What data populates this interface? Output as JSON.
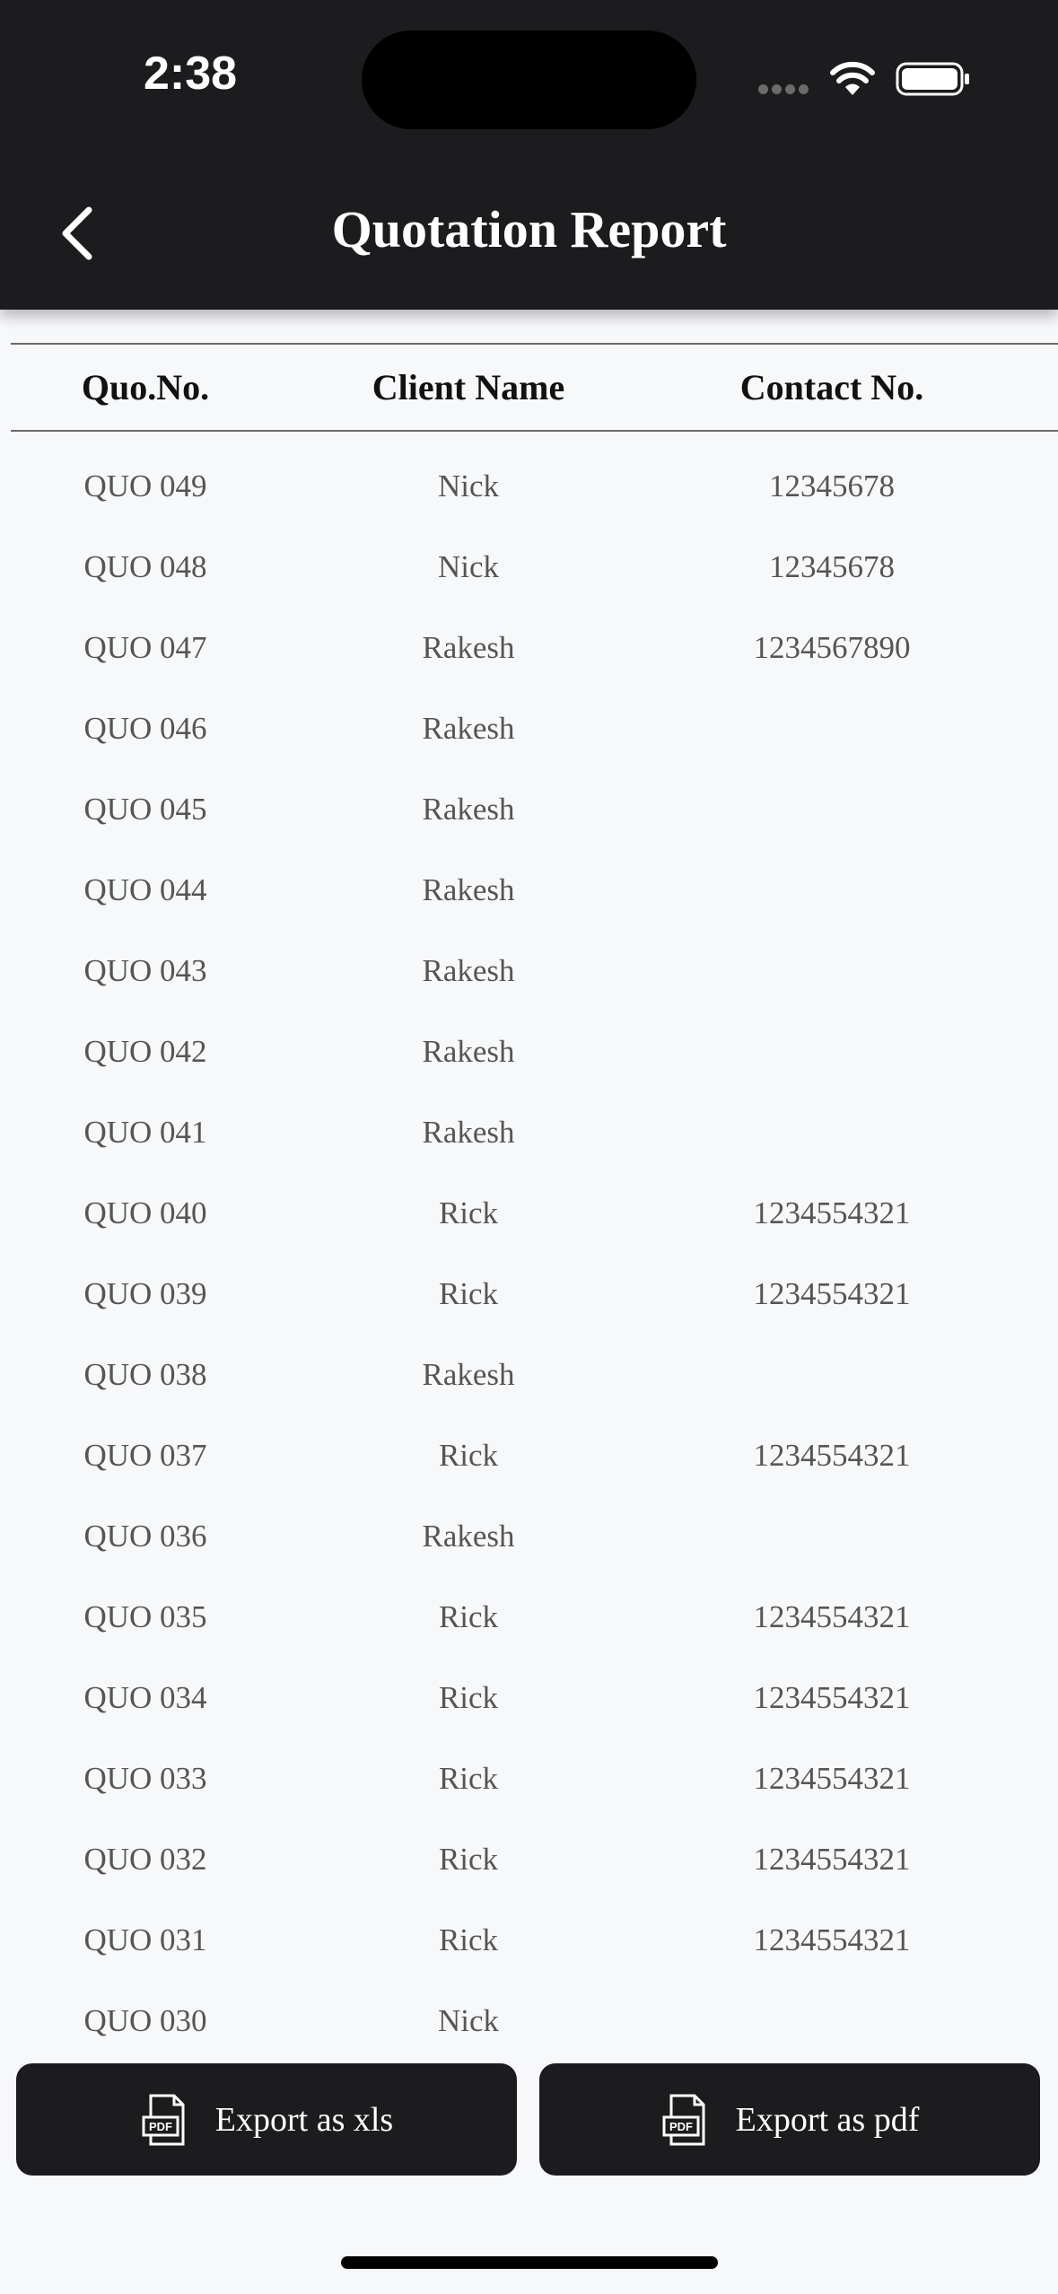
{
  "status_bar": {
    "time": "2:38"
  },
  "header": {
    "title": "Quotation Report",
    "back_icon": "chevron-left-icon"
  },
  "table": {
    "columns": [
      "Quo.No.",
      "Client Name",
      "Contact No."
    ],
    "rows": [
      [
        "QUO 049",
        "Nick",
        "12345678"
      ],
      [
        "QUO 048",
        "Nick",
        "12345678"
      ],
      [
        "QUO 047",
        "Rakesh",
        "1234567890"
      ],
      [
        "QUO 046",
        "Rakesh",
        ""
      ],
      [
        "QUO 045",
        "Rakesh",
        ""
      ],
      [
        "QUO 044",
        "Rakesh",
        ""
      ],
      [
        "QUO 043",
        "Rakesh",
        ""
      ],
      [
        "QUO 042",
        "Rakesh",
        ""
      ],
      [
        "QUO 041",
        "Rakesh",
        ""
      ],
      [
        "QUO 040",
        "Rick",
        "1234554321"
      ],
      [
        "QUO 039",
        "Rick",
        "1234554321"
      ],
      [
        "QUO 038",
        "Rakesh",
        ""
      ],
      [
        "QUO 037",
        "Rick",
        "1234554321"
      ],
      [
        "QUO 036",
        "Rakesh",
        ""
      ],
      [
        "QUO 035",
        "Rick",
        "1234554321"
      ],
      [
        "QUO 034",
        "Rick",
        "1234554321"
      ],
      [
        "QUO 033",
        "Rick",
        "1234554321"
      ],
      [
        "QUO 032",
        "Rick",
        "1234554321"
      ],
      [
        "QUO 031",
        "Rick",
        "1234554321"
      ],
      [
        "QUO 030",
        "Nick",
        ""
      ]
    ]
  },
  "footer": {
    "export_xls": {
      "label": "Export as xls",
      "icon": "pdf-file-icon"
    },
    "export_pdf": {
      "label": "Export as pdf",
      "icon": "pdf-file-icon"
    },
    "pdf_icon_text": "PDF"
  },
  "colors": {
    "header_bg": "#1c1c1e",
    "page_bg": "#f7f8fa",
    "row_text": "#555555"
  }
}
